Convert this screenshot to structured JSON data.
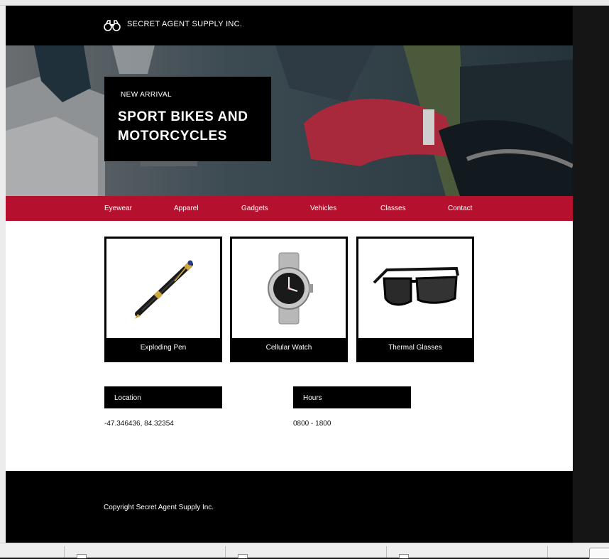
{
  "header": {
    "logo_icon": "binoculars-icon",
    "brand": "SECRET AGENT SUPPLY INC."
  },
  "hero": {
    "kicker": "NEW ARRIVAL",
    "title": "SPORT BIKES AND MOTORCYCLES",
    "image": "motorcycle-photo"
  },
  "nav": {
    "items": [
      {
        "label": "Eyewear"
      },
      {
        "label": "Apparel"
      },
      {
        "label": "Gadgets"
      },
      {
        "label": "Vehicles"
      },
      {
        "label": "Classes"
      },
      {
        "label": "Contact"
      }
    ]
  },
  "products": [
    {
      "name": "Exploding Pen",
      "image": "pen-image"
    },
    {
      "name": "Cellular Watch",
      "image": "watch-image"
    },
    {
      "name": "Thermal Glasses",
      "image": "glasses-image"
    }
  ],
  "info": {
    "location_label": "Location",
    "location_value": "-47.346436, 84.32354",
    "hours_label": "Hours",
    "hours_value": "0800 - 1800"
  },
  "footer": {
    "copyright": "Copyright Secret Agent Supply Inc."
  },
  "colors": {
    "nav_red": "#b5102d",
    "dark": "#000000",
    "content_bg": "#ffffff"
  }
}
